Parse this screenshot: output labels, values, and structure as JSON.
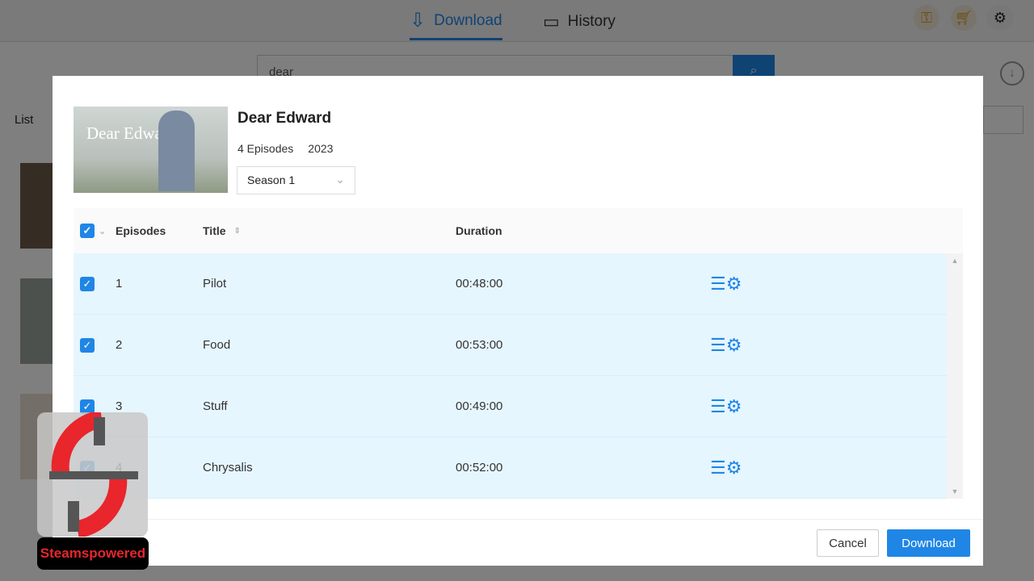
{
  "topbar": {
    "tabs": [
      {
        "label": "Download",
        "icon": "download-monitor-icon",
        "active": true
      },
      {
        "label": "History",
        "icon": "monitor-icon"
      }
    ],
    "icons": [
      "key-icon",
      "cart-icon",
      "gear-icon"
    ]
  },
  "search": {
    "value": "dear"
  },
  "list": {
    "label": "List"
  },
  "modal": {
    "title": "Dear Edward",
    "poster_text": "Dear Edward",
    "episodes_count": "4 Episodes",
    "year": "2023",
    "season": "Season 1",
    "columns": {
      "episodes": "Episodes",
      "title": "Title",
      "duration": "Duration"
    },
    "rows": [
      {
        "num": "1",
        "title": "Pilot",
        "duration": "00:48:00",
        "checked": true
      },
      {
        "num": "2",
        "title": "Food",
        "duration": "00:53:00",
        "checked": true
      },
      {
        "num": "3",
        "title": "Stuff",
        "duration": "00:49:00",
        "checked": true
      },
      {
        "num": "4",
        "title": "Chrysalis",
        "duration": "00:52:00",
        "checked": true
      }
    ],
    "cancel": "Cancel",
    "download": "Download"
  },
  "watermark": {
    "text": "Steamspowered"
  },
  "colors": {
    "accent": "#1f86e6",
    "row_bg": "#e6f6fe"
  }
}
